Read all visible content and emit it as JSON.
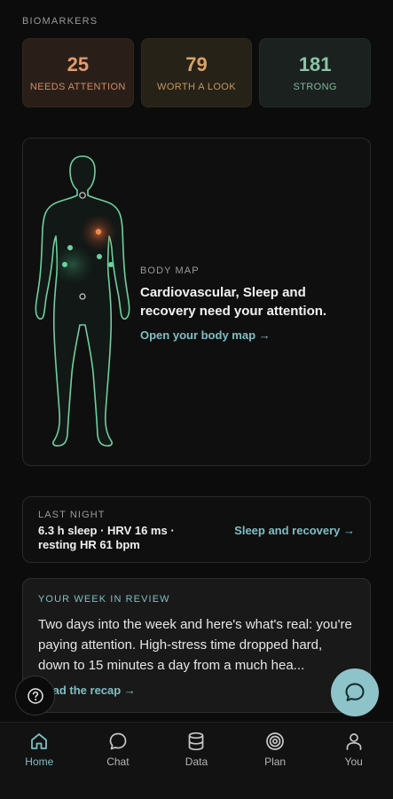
{
  "biomarkers": {
    "section_label": "BIOMARKERS",
    "tiles": [
      {
        "value": "25",
        "label": "NEEDS ATTENTION"
      },
      {
        "value": "79",
        "label": "WORTH A LOOK"
      },
      {
        "value": "181",
        "label": "STRONG"
      }
    ]
  },
  "body_map": {
    "kicker": "BODY MAP",
    "headline": "Cardiovascular, Sleep and recovery need your attention.",
    "link": "Open your body map →"
  },
  "last_night": {
    "kicker": "LAST NIGHT",
    "line1": "6.3 h sleep · HRV 16 ms ·",
    "line2": "resting HR 61 bpm",
    "link": "Sleep and recovery →"
  },
  "week_review": {
    "kicker": "YOUR WEEK IN REVIEW",
    "body": "Two days into the week and here's what's real: you're paying attention.  High-stress time dropped hard, down to 15 minutes a day from a much hea...",
    "link": "Read the recap →"
  },
  "fabs": {
    "help_icon": "question-circle-icon",
    "chat_icon": "chat-bubble-icon"
  },
  "tabs": [
    {
      "label": "Home",
      "icon": "home-icon",
      "active": true
    },
    {
      "label": "Chat",
      "icon": "chat-icon",
      "active": false
    },
    {
      "label": "Data",
      "icon": "database-icon",
      "active": false
    },
    {
      "label": "Plan",
      "icon": "target-icon",
      "active": false
    },
    {
      "label": "You",
      "icon": "user-icon",
      "active": false
    }
  ],
  "colors": {
    "accent": "#7fbfc4",
    "attention": "#e39a6e",
    "worth_a_look": "#d6a468",
    "strong": "#8cc4a6",
    "body_outline": "#6fd0a0"
  }
}
